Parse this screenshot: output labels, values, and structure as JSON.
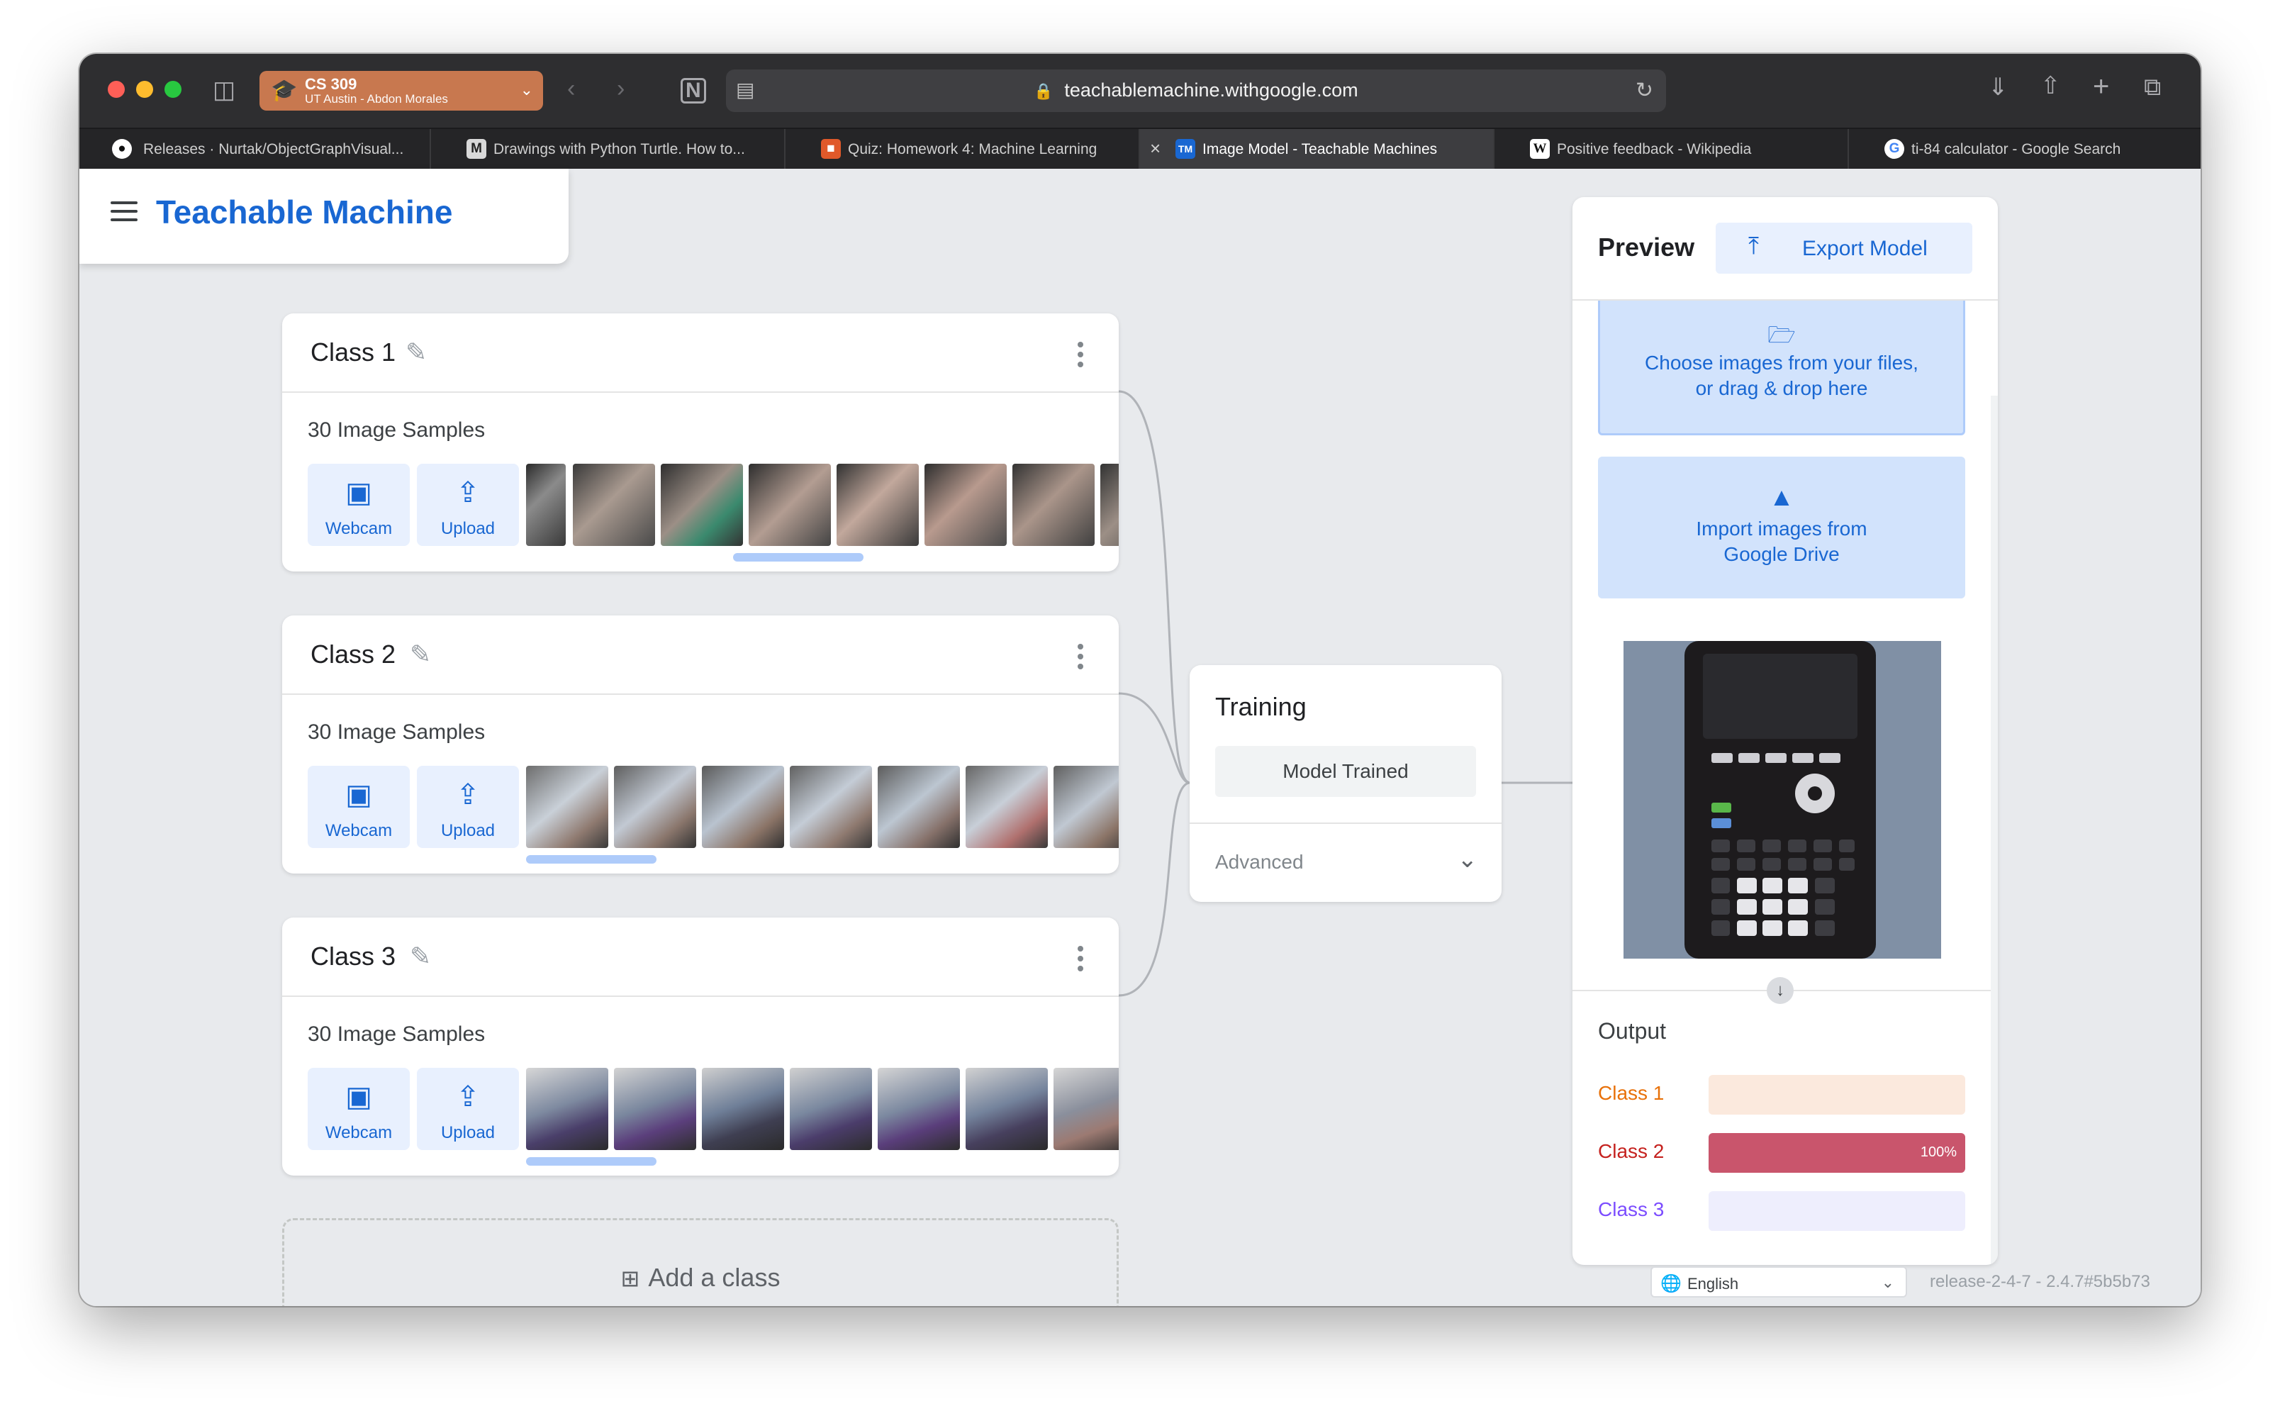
{
  "browser": {
    "profile": {
      "name": "CS 309",
      "subtitle": "UT Austin - Abdon Morales"
    },
    "url": "teachablemachine.withgoogle.com",
    "tabs": [
      {
        "title": "Releases · Nurtak/ObjectGraphVisual...",
        "favicon": "github-icon",
        "active": false
      },
      {
        "title": "Drawings with Python Turtle. How to...",
        "favicon": "medium-icon",
        "fav_char": "M",
        "active": false
      },
      {
        "title": "Quiz: Homework 4: Machine Learning",
        "favicon": "canvas-icon",
        "active": false
      },
      {
        "title": "Image Model - Teachable Machines",
        "favicon": "tm-icon",
        "fav_char": "TM",
        "active": true
      },
      {
        "title": "Positive feedback - Wikipedia",
        "favicon": "wikipedia-icon",
        "fav_char": "W",
        "active": false
      },
      {
        "title": "ti-84 calculator - Google Search",
        "favicon": "google-icon",
        "fav_char": "G",
        "active": false
      }
    ]
  },
  "app": {
    "brand": "Teachable Machine",
    "classes": [
      {
        "name": "Class 1",
        "samples_label": "30 Image Samples",
        "webcam": "Webcam",
        "upload": "Upload"
      },
      {
        "name": "Class 2",
        "samples_label": "30 Image Samples",
        "webcam": "Webcam",
        "upload": "Upload"
      },
      {
        "name": "Class 3",
        "samples_label": "30 Image Samples",
        "webcam": "Webcam",
        "upload": "Upload"
      }
    ],
    "add_class": "Add a class",
    "training": {
      "title": "Training",
      "button": "Model Trained",
      "advanced": "Advanced"
    },
    "preview": {
      "title": "Preview",
      "export": "Export Model",
      "dropzone_line1": "Choose images from your files,",
      "dropzone_line2": "or drag & drop here",
      "gdrive_line1": "Import images from",
      "gdrive_line2": "Google Drive",
      "output_title": "Output",
      "outputs": [
        {
          "label": "Class 1",
          "percent": 0,
          "percent_label": "",
          "color": "#e8710a",
          "track": "#fbe9dd"
        },
        {
          "label": "Class 2",
          "percent": 100,
          "percent_label": "100%",
          "color": "#c5221f",
          "track": "#f3d6dc",
          "fill": "#c9556c"
        },
        {
          "label": "Class 3",
          "percent": 0,
          "percent_label": "",
          "color": "#7c4dff",
          "track": "#eeeefd"
        }
      ]
    },
    "language": "English",
    "release": "release-2-4-7 - 2.4.7#5b5b73"
  }
}
